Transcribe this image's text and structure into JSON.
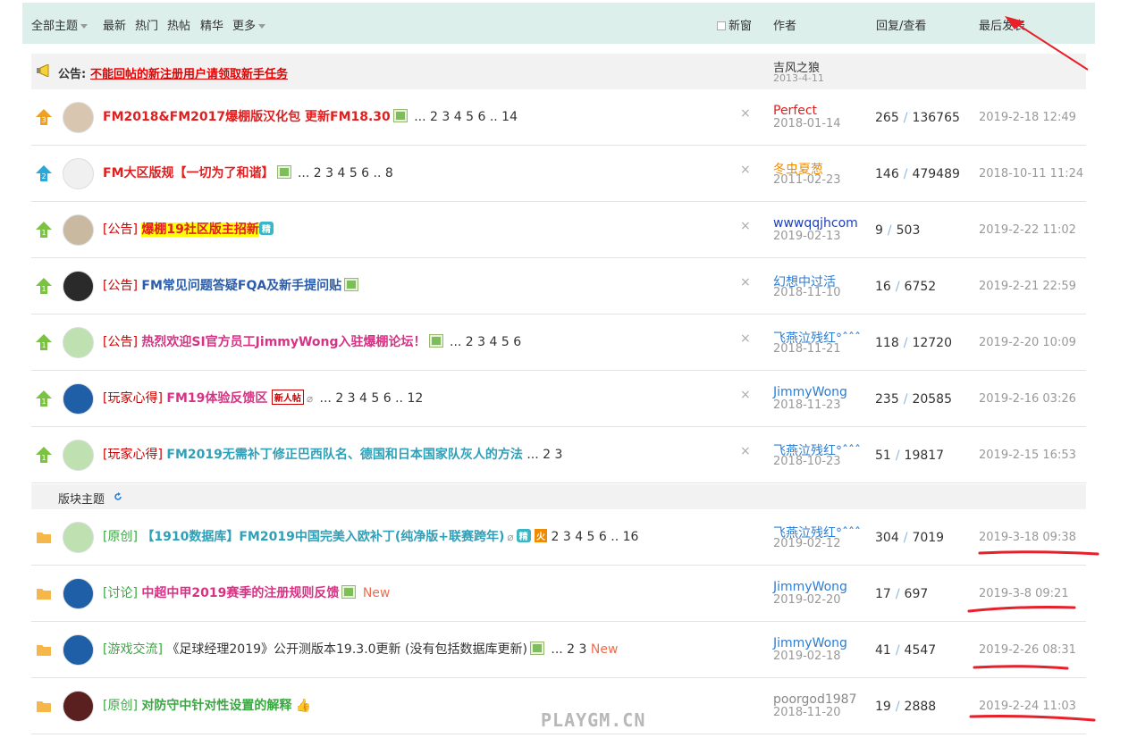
{
  "header": {
    "all_topics": "全部主题",
    "latest": "最新",
    "hot": "热门",
    "hot_posts": "热帖",
    "digest": "精华",
    "more": "更多",
    "new_window": "新窗",
    "author_col": "作者",
    "reply_view_col": "回复/查看",
    "last_post_col": "最后发表"
  },
  "announcement": {
    "label": "公告:",
    "link": "不能回帖的新注册用户请领取新手任务",
    "author": "吉风之狼",
    "date": "2013-4-11"
  },
  "sticky_rows": [
    {
      "prefix": "",
      "title": "FM2018&FM2017爆棚版汉化包 更新FM18.30",
      "title_color": "#e02020",
      "pages": "... 2 3 4 5 6 .. 14",
      "author": "Perfect",
      "author_color": "#e02020",
      "author_date": "2018-01-14",
      "replies": "265",
      "views": "136765",
      "last": "2019-2-18 12:49",
      "icon": "sticky-3",
      "avatar": "#d9c6b0"
    },
    {
      "prefix": "",
      "title": "FM大区版规【一切为了和谐】",
      "title_color": "#e02020",
      "pages": "... 2 3 4 5 6 .. 8",
      "author": "冬虫夏葱",
      "author_color": "#f08b00",
      "author_date": "2011-02-23",
      "replies": "146",
      "views": "479489",
      "last": "2018-10-11 11:24",
      "icon": "sticky-2",
      "avatar": "#f0f0f0"
    },
    {
      "prefix": "[公告]",
      "title": "爆棚19社区版主招新",
      "title_color": "#e02020",
      "pages": "",
      "author": "wwwqqjhcom",
      "author_color": "#1a3fbf",
      "author_date": "2019-02-13",
      "replies": "9",
      "views": "503",
      "last": "2019-2-22 11:02",
      "icon": "sticky-1",
      "avatar": "#c8b9a0"
    },
    {
      "prefix": "[公告]",
      "title": "FM常见问题答疑FQA及新手提问贴",
      "title_color": "#2b5caa",
      "pages": "",
      "author": "幻想中过活",
      "author_color": "#2b7cd3",
      "author_date": "2018-11-10",
      "replies": "16",
      "views": "6752",
      "last": "2019-2-21 22:59",
      "icon": "sticky-1",
      "avatar": "#2a2a2a"
    },
    {
      "prefix": "[公告]",
      "title": "热烈欢迎SI官方员工JimmyWong入驻爆棚论坛！",
      "title_color": "#d63384",
      "pages": "... 2 3 4 5 6",
      "author": "飞燕泣残红°ˆˆˆ",
      "author_color": "#2b7cd3",
      "author_date": "2018-11-21",
      "replies": "118",
      "views": "12720",
      "last": "2019-2-20 10:09",
      "icon": "sticky-1",
      "avatar": "#bfe0b0"
    },
    {
      "prefix": "[玩家心得]",
      "title": "FM19体验反馈区",
      "title_color": "#d63384",
      "pages": "... 2 3 4 5 6 .. 12",
      "author": "JimmyWong",
      "author_color": "#2b7cd3",
      "author_date": "2018-11-23",
      "replies": "235",
      "views": "20585",
      "last": "2019-2-16 03:26",
      "icon": "sticky-1",
      "avatar": "#1f5fa8"
    },
    {
      "prefix": "[玩家心得]",
      "title": "FM2019无需补丁修正巴西队名、德国和日本国家队灰人的方法",
      "title_color": "#2ea0b8",
      "pages": "... 2 3",
      "author": "飞燕泣残红°ˆˆˆ",
      "author_color": "#2b7cd3",
      "author_date": "2018-10-23",
      "replies": "51",
      "views": "19817",
      "last": "2019-2-15 16:53",
      "icon": "sticky-1",
      "avatar": "#bfe0b0"
    }
  ],
  "separator": {
    "label": "版块主题"
  },
  "normal_rows": [
    {
      "prefix": "[原创]",
      "title": "【1910数据库】FM2019中国完美入欧补丁(纯净版+联赛跨年)",
      "title_color": "#2ea0b8",
      "pages": "2 3 4 5 6 .. 16",
      "new": "",
      "author": "飞燕泣残红°ˆˆˆ",
      "author_color": "#2b7cd3",
      "author_date": "2019-02-12",
      "replies": "304",
      "views": "7019",
      "last": "2019-3-18 09:38",
      "avatar": "#bfe0b0"
    },
    {
      "prefix": "[讨论]",
      "title": "中超中甲2019赛季的注册规则反馈",
      "title_color": "#d63384",
      "pages": "",
      "new": "New",
      "author": "JimmyWong",
      "author_color": "#2b7cd3",
      "author_date": "2019-02-20",
      "replies": "17",
      "views": "697",
      "last": "2019-3-8 09:21",
      "avatar": "#1f5fa8"
    },
    {
      "prefix": "[游戏交流]",
      "title": "《足球经理2019》公开测版本19.3.0更新 (没有包括数据库更新)",
      "title_color": "#333333",
      "pages": "... 2 3",
      "new": "New",
      "author": "JimmyWong",
      "author_color": "#2b7cd3",
      "author_date": "2019-02-18",
      "replies": "41",
      "views": "4547",
      "last": "2019-2-26 08:31",
      "avatar": "#1f5fa8"
    },
    {
      "prefix": "[原创]",
      "title": "对防守中针对性设置的解释",
      "title_color": "#3aa840",
      "pages": "",
      "new": "",
      "author": "poorgod1987",
      "author_color": "#888888",
      "author_date": "2018-11-20",
      "replies": "19",
      "views": "2888",
      "last": "2019-2-24 11:03",
      "avatar": "#5a2020"
    }
  ],
  "badges": {
    "jing": "精",
    "new_post": "新人帖",
    "hot": "火"
  },
  "watermark": "PLAYGM.CN",
  "colors": {
    "header_bg": "#dcefea",
    "announce_bg": "#f2f2f2",
    "annotation_red": "#e8202a"
  }
}
